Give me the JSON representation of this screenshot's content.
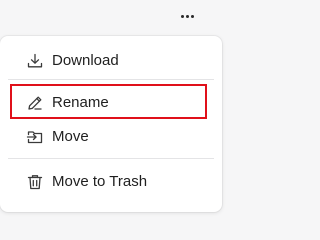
{
  "more_button": {
    "icon": "more-horizontal-icon"
  },
  "menu": {
    "items": [
      {
        "label": "Download",
        "icon": "download-icon"
      },
      {
        "label": "Rename",
        "icon": "pencil-icon"
      },
      {
        "label": "Move",
        "icon": "move-icon"
      },
      {
        "label": "Move to Trash",
        "icon": "trash-icon"
      }
    ]
  },
  "highlight": {
    "target": "Rename",
    "color": "#e0101a"
  }
}
